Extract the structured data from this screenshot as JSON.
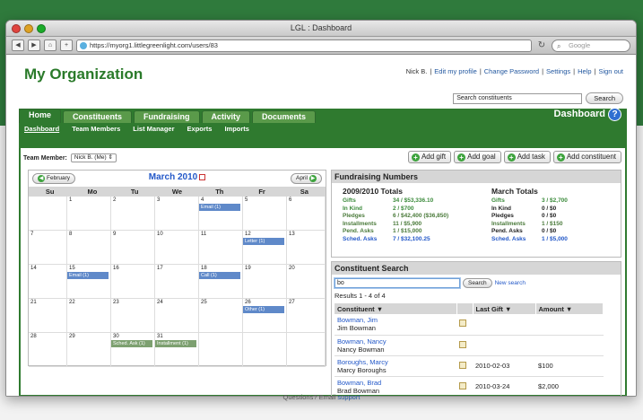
{
  "window": {
    "title": "LGL : Dashboard"
  },
  "browser": {
    "url": "https://myorg1.littlegreenlight.com/users/83",
    "search_placeholder": "Google"
  },
  "header": {
    "org_name": "My Organization",
    "user": "Nick B.",
    "links": [
      "Edit my profile",
      "Change Password",
      "Settings",
      "Help",
      "Sign out"
    ],
    "search_value": "Search constituents",
    "search_button": "Search"
  },
  "nav": {
    "tabs": [
      "Home",
      "Constituents",
      "Fundraising",
      "Activity",
      "Documents"
    ],
    "section_title": "Dashboard",
    "help": "?",
    "subnav": [
      "Dashboard",
      "Team Members",
      "List Manager",
      "Exports",
      "Imports"
    ]
  },
  "team": {
    "label": "Team Member:",
    "selected": "Nick B. (Me)"
  },
  "actions": [
    "Add gift",
    "Add goal",
    "Add task",
    "Add constituent"
  ],
  "calendar": {
    "title": "March 2010",
    "prev": "February",
    "next": "April",
    "days_of_week": [
      "Su",
      "Mo",
      "Tu",
      "We",
      "Th",
      "Fr",
      "Sa"
    ],
    "weeks": [
      [
        {
          "d": ""
        },
        {
          "d": "1"
        },
        {
          "d": "2"
        },
        {
          "d": "3"
        },
        {
          "d": "4",
          "e": "Email (1)",
          "c": "blue"
        },
        {
          "d": "5"
        },
        {
          "d": "6"
        }
      ],
      [
        {
          "d": "7"
        },
        {
          "d": "8"
        },
        {
          "d": "9"
        },
        {
          "d": "10"
        },
        {
          "d": "11"
        },
        {
          "d": "12",
          "e": "Letter (1)",
          "c": "blue"
        },
        {
          "d": "13"
        }
      ],
      [
        {
          "d": "14"
        },
        {
          "d": "15",
          "e": "Email (1)",
          "c": "blue"
        },
        {
          "d": "16"
        },
        {
          "d": "17"
        },
        {
          "d": "18",
          "e": "Call (1)",
          "c": "blue"
        },
        {
          "d": "19"
        },
        {
          "d": "20"
        }
      ],
      [
        {
          "d": "21"
        },
        {
          "d": "22"
        },
        {
          "d": "23"
        },
        {
          "d": "24"
        },
        {
          "d": "25"
        },
        {
          "d": "26",
          "e": "Other (1)",
          "c": "blue"
        },
        {
          "d": "27"
        }
      ],
      [
        {
          "d": "28"
        },
        {
          "d": "29"
        },
        {
          "d": "30",
          "e": "Sched. Ask (1)",
          "c": "green"
        },
        {
          "d": "31",
          "e": "Installment (1)",
          "c": "green"
        },
        {
          "d": ""
        },
        {
          "d": ""
        },
        {
          "d": ""
        }
      ]
    ]
  },
  "fundraising": {
    "title": "Fundraising Numbers",
    "col1": {
      "heading": "2009/2010 Totals",
      "rows": [
        {
          "k": "Gifts",
          "v": "34 / $53,336.10",
          "c": "green"
        },
        {
          "k": "In Kind",
          "v": "2 / $700",
          "c": "green"
        },
        {
          "k": "Pledges",
          "v": "6 / $42,400 ($36,850)",
          "c": "gray"
        },
        {
          "k": "Installments",
          "v": "11 / $5,900",
          "c": "gray"
        },
        {
          "k": "Pend. Asks",
          "v": "1 / $15,000",
          "c": "gray"
        },
        {
          "k": "Sched. Asks",
          "v": "7 / $32,100.25",
          "c": "blue"
        }
      ]
    },
    "col2": {
      "heading": "March Totals",
      "rows": [
        {
          "k": "Gifts",
          "v": "3 / $2,700",
          "c": "green"
        },
        {
          "k": "In Kind",
          "v": "0 / $0",
          "c": "black"
        },
        {
          "k": "Pledges",
          "v": "0 / $0",
          "c": "black"
        },
        {
          "k": "Installments",
          "v": "1 / $150",
          "c": "gray"
        },
        {
          "k": "Pend. Asks",
          "v": "0 / $0",
          "c": "black"
        },
        {
          "k": "Sched. Asks",
          "v": "1 / $5,000",
          "c": "blue"
        }
      ]
    }
  },
  "constituent_search": {
    "title": "Constituent Search",
    "query": "bo",
    "button": "Search",
    "new_search": "New search",
    "results_text": "Results 1 - 4 of 4",
    "columns": [
      "Constituent ▼",
      "Last Gift ▼",
      "Amount ▼"
    ],
    "rows": [
      {
        "link": "Bowman, Jim",
        "name": "Jim Bowman",
        "last_gift": "",
        "amount": ""
      },
      {
        "link": "Bowman, Nancy",
        "name": "Nancy Bowman",
        "last_gift": "",
        "amount": ""
      },
      {
        "link": "Boroughs, Marcy",
        "name": "Marcy Boroughs",
        "last_gift": "2010-02-03",
        "amount": "$100"
      },
      {
        "link": "Bowman, Brad",
        "name": "Brad Bowman",
        "last_gift": "2010-03-24",
        "amount": "$2,000"
      }
    ]
  },
  "footer": {
    "text": "Questions? Email",
    "link": "support"
  }
}
